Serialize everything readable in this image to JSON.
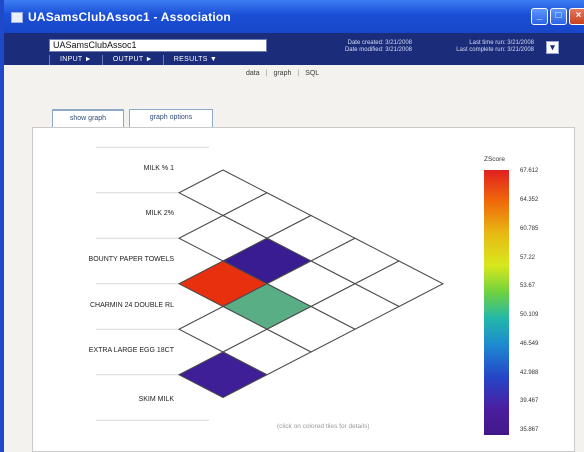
{
  "window": {
    "title": "UASamsClubAssoc1 - Association"
  },
  "header": {
    "name_value": "UASamsClubAssoc1",
    "meta": [
      {
        "label": "Date created: 3/21/2008"
      },
      {
        "label": "Date modified: 3/21/2008"
      },
      {
        "label": "Last time run: 3/21/2008"
      },
      {
        "label": "Last complete run: 3/21/2008"
      }
    ],
    "menu": [
      "INPUT ►",
      "OUTPUT ►",
      "RESULTS ▼"
    ]
  },
  "view_links": [
    "data",
    "graph",
    "SQL"
  ],
  "tabs": [
    {
      "label": "show graph",
      "active": true
    },
    {
      "label": "graph options",
      "active": false
    }
  ],
  "items": [
    "MILK % 1",
    "MILK 2%",
    "BOUNTY PAPER TOWELS",
    "CHARMIN 24 DOUBLE RL",
    "EXTRA LARGE EGG 18CT",
    "SKIM MILK"
  ],
  "highlighted_cells": [
    {
      "pair": [
        "BOUNTY PAPER TOWELS",
        "CHARMIN 24 DOUBLE RL"
      ],
      "color": "#e8300e"
    },
    {
      "pair": [
        "BOUNTY PAPER TOWELS",
        "EXTRA LARGE EGG 18CT"
      ],
      "color": "#5aae86"
    },
    {
      "pair": [
        "MILK 2%",
        "CHARMIN 24 DOUBLE RL"
      ],
      "color": "#3a1c92"
    },
    {
      "pair": [
        "EXTRA LARGE EGG 18CT",
        "SKIM MILK"
      ],
      "color": "#3f1f98"
    }
  ],
  "hint": "(click on colored tiles for details)",
  "legend": {
    "title": "ZScore",
    "ticks": [
      "67.612",
      "64.352",
      "60.785",
      "57.22",
      "53.67",
      "50.109",
      "46.549",
      "42.988",
      "39.467",
      "35.867"
    ]
  }
}
